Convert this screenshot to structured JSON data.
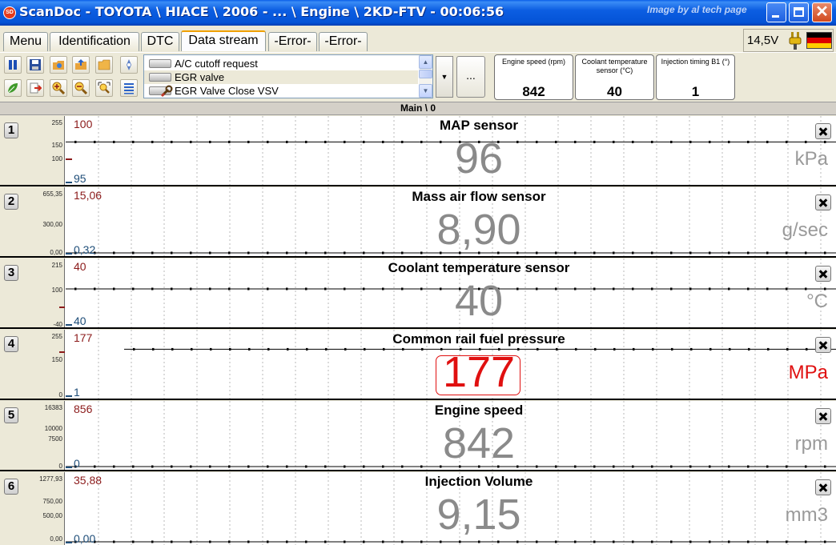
{
  "window": {
    "title": "ScanDoc - TOYOTA \\ HIACE \\ 2006 - ... \\ Engine \\ 2KD-FTV - 00:06:56",
    "watermark": "Image by al tech page",
    "app_icon": "SD",
    "title_bar_color": "#0453d6"
  },
  "tabs": [
    {
      "label": "Menu",
      "active": false
    },
    {
      "label": "Identification",
      "active": false
    },
    {
      "label": "DTC",
      "active": false
    },
    {
      "label": "Data stream",
      "active": true
    },
    {
      "label": "-Error-",
      "active": false
    },
    {
      "label": "-Error-",
      "active": false
    }
  ],
  "status": {
    "voltage": "14,5V",
    "plug_icon": "plug-icon",
    "flag_icon": "german-flag-icon",
    "flag_colors": [
      "#000000",
      "#dd0000",
      "#ffce00"
    ]
  },
  "toolbar": {
    "row1_icons": [
      "pause-icon",
      "save-icon",
      "open-icon",
      "import-icon",
      "folder-icon",
      "settings-icon"
    ],
    "row2_icons": [
      "leaf-icon",
      "export-icon",
      "zoom-in-icon",
      "zoom-out-icon",
      "zoom-fit-icon",
      "list-icon"
    ],
    "more_label": "..."
  },
  "param_list": {
    "items": [
      {
        "label": "A/C cutoff request",
        "selected": false,
        "icon": "toggle-icon"
      },
      {
        "label": "EGR valve",
        "selected": true,
        "icon": "toggle-icon"
      },
      {
        "label": "EGR Valve Close VSV",
        "selected": false,
        "icon": "wrench-icon"
      }
    ]
  },
  "readouts": [
    {
      "label": "Engine speed  (rpm)",
      "value": "842"
    },
    {
      "label": "Coolant temperature sensor  (°C)",
      "value": "40"
    },
    {
      "label": "Injection timing B1 (°)",
      "value": "1"
    }
  ],
  "path": "Main \\ 0",
  "panels": [
    {
      "num": "1",
      "title": "MAP sensor",
      "value": "96",
      "unit": "kPa",
      "max": "100",
      "min": "95",
      "ticks": [
        "255",
        "150",
        "100"
      ],
      "alarm": false,
      "level": 0.62
    },
    {
      "num": "2",
      "title": "Mass air flow sensor",
      "value": "8,90",
      "unit": "g/sec",
      "max": "15,06",
      "min": "0,32",
      "ticks": [
        "655,35",
        "300,00",
        "0,00"
      ],
      "alarm": false,
      "level": 0.0
    },
    {
      "num": "3",
      "title": "Coolant temperature sensor",
      "value": "40",
      "unit": "°C",
      "max": "40",
      "min": "40",
      "ticks": [
        "215",
        "100",
        "-40"
      ],
      "alarm": false,
      "level": 0.55
    },
    {
      "num": "4",
      "title": "Common rail fuel pressure",
      "value": "177",
      "unit": "MPa",
      "max": "177",
      "min": "1",
      "ticks": [
        "255",
        "150",
        "0"
      ],
      "alarm": true,
      "level": 0.72
    },
    {
      "num": "5",
      "title": "Engine speed",
      "value": "842",
      "unit": "rpm",
      "max": "856",
      "min": "0",
      "ticks": [
        "16383",
        "10000",
        "7500",
        "0"
      ],
      "alarm": false,
      "level": 0.0
    },
    {
      "num": "6",
      "title": "Injection Volume",
      "value": "9,15",
      "unit": "mm3",
      "max": "35,88",
      "min": "0,00",
      "ticks": [
        "1277,93",
        "750,00",
        "500,00",
        "0,00"
      ],
      "alarm": false,
      "level": 0.0
    }
  ]
}
